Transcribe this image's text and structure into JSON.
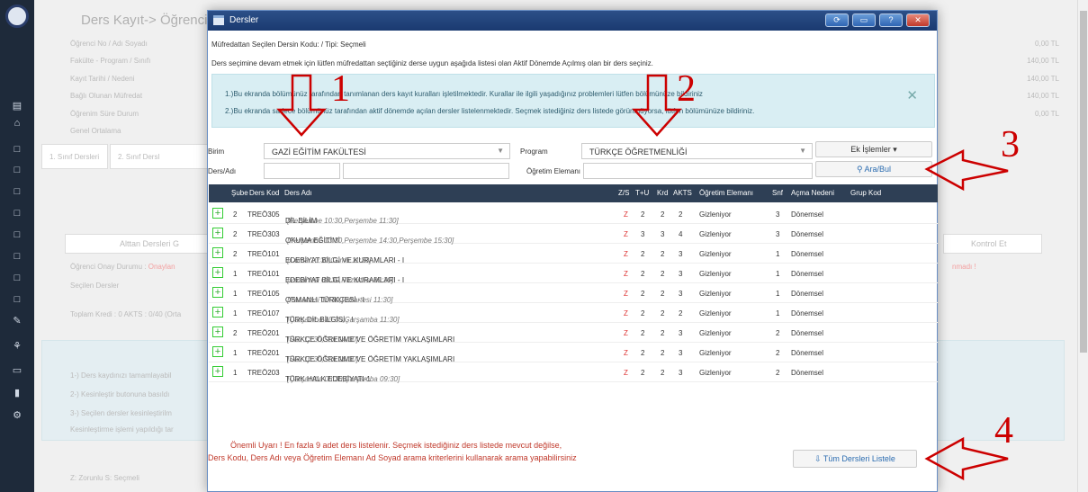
{
  "background": {
    "title": "Ders Kayıt-> Öğrenci",
    "left_labels": [
      "Öğrenci No / Adı Soyadı",
      "Fakülte - Program / Sınıfı",
      "Kayıt Tarihi / Nedeni",
      "Bağlı Olunan Müfredat",
      "Öğrenim Süre Durum",
      "Genel Ortalama"
    ],
    "fees": [
      "0,00 TL",
      "140,00 TL",
      "140,00 TL",
      "140,00 TL",
      "0,00 TL"
    ],
    "tab1": "1. Sınıf Dersleri",
    "tab2": "2. Sınıf Dersl",
    "alttan": "Alttan Dersleri G",
    "kontrol": "Kontrol Et",
    "onay_label": "Öğrenci Onay Durumu :",
    "onay_value": "Onaylan",
    "secilen": "Seçilen Dersler",
    "toplam": "Toplam Kredi : 0 AKTS : 0/40 (Orta",
    "right_red": "nmadı !",
    "notes": [
      "1-) Ders kaydınızı tamamlayabil",
      "2-) Kesinleştir butonuna basıldı",
      "3-) Seçilen dersler kesinleştirilm",
      "Kesinleştirme işlemi yapıldığı tar"
    ],
    "legend": "Z: Zorunlu S: Seçmeli"
  },
  "dialog": {
    "title": "Dersler",
    "buttons": [
      "⟳",
      "▭",
      "?",
      "✕"
    ],
    "info_line1": "Müfredattan Seçilen Dersin Kodu: / Tipi: Seçmeli",
    "info_line2": "Ders seçimine devam etmek için lütfen müfredattan seçtiğiniz derse uygun aşağıda listesi olan Aktif Dönemde Açılmış olan bir ders seçiniz.",
    "alert1": "1.)Bu ekranda bölümünüz tarafından tanımlanan ders kayıt kuralları işletilmektedir. Kurallar ile ilgili yaşadığınız problemleri lütfen bölümünüze bildiriniz",
    "alert2": "2.)Bu ekranda sadece bölümünüz tarafından aktif dönemde açılan dersler listelenmektedir. Seçmek istediğiniz ders listede görünmüyorsa, lütfen bölümünüze bildiriniz.",
    "alert_close": "✕"
  },
  "filters": {
    "birim_label": "Birim",
    "birim_value": "GAZİ EĞİTİM FAKÜLTESİ",
    "program_label": "Program",
    "program_value": "TÜRKÇE ÖĞRETMENLİĞİ",
    "ek_islemler": "Ek İşlemler ▾",
    "ders_label": "Ders/Adı",
    "ogretim_label": "Öğretim Elemanı",
    "ara_bul": "Ara/Bul"
  },
  "table": {
    "headers": [
      "Şube",
      "Ders Kod",
      "Ders Adı",
      "Z/S",
      "T+U",
      "Krd",
      "AKTS",
      "Öğretim Elemanı",
      "Snf",
      "Açma Nedeni",
      "Grup Kod"
    ],
    "rows": [
      {
        "sube": "2",
        "kod": "TREÖ305",
        "ad": "DİL BİLİM",
        "sched": "[Perşembe 10:30,Perşembe 11:30]",
        "zs": "Z",
        "tu": "2",
        "krd": "2",
        "akts": "2",
        "ogr": "Gizleniyor",
        "snf": "3",
        "neden": "Dönemsel"
      },
      {
        "sube": "2",
        "kod": "TREÖ303",
        "ad": "OKUMA EĞİTİMİ",
        "sched": "[Perşembe 13:30,Perşembe 14:30,Perşembe 15:30]",
        "zs": "Z",
        "tu": "3",
        "krd": "3",
        "akts": "4",
        "ogr": "Gizleniyor",
        "snf": "3",
        "neden": "Dönemsel"
      },
      {
        "sube": "2",
        "kod": "TREÖ101",
        "ad": "EDEBİYAT BİLGİ VE KURAMLARI - I",
        "sched": "[Cuma 10:30,Cuma 11:30]",
        "zs": "Z",
        "tu": "2",
        "krd": "2",
        "akts": "3",
        "ogr": "Gizleniyor",
        "snf": "1",
        "neden": "Dönemsel"
      },
      {
        "sube": "1",
        "kod": "TREÖ101",
        "ad": "EDEBİYAT BİLGİ VE KURAMLARI - I",
        "sched": "[Pazartesi 08:30,Pazartesi 09:30]",
        "zs": "Z",
        "tu": "2",
        "krd": "2",
        "akts": "3",
        "ogr": "Gizleniyor",
        "snf": "1",
        "neden": "Dönemsel"
      },
      {
        "sube": "1",
        "kod": "TREÖ105",
        "ad": "OSMANLI TÜRKÇESİ - I",
        "sched": "[Pazartesi 10:30,Pazartesi 11:30]",
        "zs": "Z",
        "tu": "2",
        "krd": "2",
        "akts": "3",
        "ogr": "Gizleniyor",
        "snf": "1",
        "neden": "Dönemsel"
      },
      {
        "sube": "1",
        "kod": "TREÖ107",
        "ad": "TÜRK DİL BİLGİSİ - I",
        "sched": "[Çarşamba 10:30,Çarşamba 11:30]",
        "zs": "Z",
        "tu": "2",
        "krd": "2",
        "akts": "2",
        "ogr": "Gizleniyor",
        "snf": "1",
        "neden": "Dönemsel"
      },
      {
        "sube": "2",
        "kod": "TREÖ201",
        "ad": "TÜRKÇE ÖĞRENME VE ÖĞRETİM YAKLAŞIMLARI",
        "sched": "[Salı 13:30,Salı 14:30]",
        "zs": "Z",
        "tu": "2",
        "krd": "2",
        "akts": "3",
        "ogr": "Gizleniyor",
        "snf": "2",
        "neden": "Dönemsel"
      },
      {
        "sube": "1",
        "kod": "TREÖ201",
        "ad": "TÜRKÇE ÖĞRENME VE ÖĞRETİM YAKLAŞIMLARI",
        "sched": "[Salı 15:30,Salı 16:30]",
        "zs": "Z",
        "tu": "2",
        "krd": "2",
        "akts": "3",
        "ogr": "Gizleniyor",
        "snf": "2",
        "neden": "Dönemsel"
      },
      {
        "sube": "1",
        "kod": "TREÖ203",
        "ad": "TÜRK HALK EDEBİYATI-1",
        "sched": "[Çarşamba 08:30,Çarşamba 09:30]",
        "zs": "Z",
        "tu": "2",
        "krd": "2",
        "akts": "3",
        "ogr": "Gizleniyor",
        "snf": "2",
        "neden": "Dönemsel"
      }
    ]
  },
  "warning": {
    "line1": "Önemli Uyarı ! En fazla 9 adet ders listelenir. Seçmek istediğiniz ders listede mevcut değilse,",
    "line2": "Ders Kodu, Ders Adı veya Öğretim Elemanı Ad Soyad arama kriterlerini kullanarak arama yapabilirsiniz"
  },
  "list_all": "Tüm Dersleri Listele",
  "annotations": [
    "1",
    "2",
    "3",
    "4"
  ],
  "colors": {
    "annotation": "#cc0000",
    "header": "#2e3f55",
    "sidebar": "#1e2a3a"
  }
}
